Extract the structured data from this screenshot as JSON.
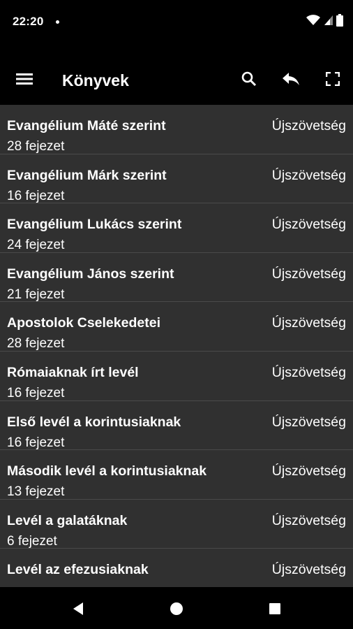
{
  "status_bar": {
    "time": "22:20"
  },
  "app_bar": {
    "title": "Könyvek",
    "icons": [
      "menu-icon",
      "search-icon",
      "reply-icon",
      "fullscreen-icon"
    ]
  },
  "books": [
    {
      "title": "Evangélium Máté szerint",
      "chapters": "28 fejezet",
      "testament": "Újszövetség"
    },
    {
      "title": "Evangélium Márk szerint",
      "chapters": "16 fejezet",
      "testament": "Újszövetség"
    },
    {
      "title": "Evangélium Lukács szerint",
      "chapters": "24 fejezet",
      "testament": "Újszövetség"
    },
    {
      "title": "Evangélium János szerint",
      "chapters": "21 fejezet",
      "testament": "Újszövetség"
    },
    {
      "title": "Apostolok Cselekedetei",
      "chapters": "28 fejezet",
      "testament": "Újszövetség"
    },
    {
      "title": "Rómaiaknak írt levél",
      "chapters": "16 fejezet",
      "testament": "Újszövetség"
    },
    {
      "title": "Első levél a korintusiaknak",
      "chapters": "16 fejezet",
      "testament": "Újszövetség"
    },
    {
      "title": "Második levél a korintusiaknak",
      "chapters": "13 fejezet",
      "testament": "Újszövetség"
    },
    {
      "title": "Levél a galatáknak",
      "chapters": "6 fejezet",
      "testament": "Újszövetség"
    },
    {
      "title": "Levél az efezusiaknak",
      "chapters": "",
      "testament": "Újszövetség"
    }
  ],
  "colors": {
    "background": "#000000",
    "list_background": "#303030",
    "divider": "#4a4a4a",
    "text": "#ffffff"
  }
}
